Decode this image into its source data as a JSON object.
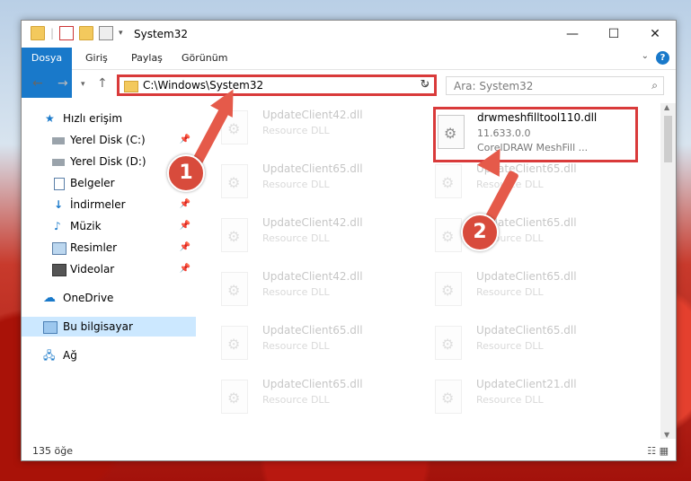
{
  "window": {
    "title": "System32",
    "controls": {
      "minimize": "—",
      "maximize": "☐",
      "close": "✕"
    }
  },
  "ribbon": {
    "tabs": [
      "Dosya",
      "Giriş",
      "Paylaş",
      "Görünüm"
    ],
    "help": "?"
  },
  "address": {
    "path": "C:\\Windows\\System32",
    "search_placeholder": "Ara: System32"
  },
  "sidebar": {
    "items": [
      {
        "label": "Hızlı erişim",
        "icon": "star-icon"
      },
      {
        "label": "Yerel Disk (C:)",
        "icon": "drive-icon",
        "pinned": true
      },
      {
        "label": "Yerel Disk (D:)",
        "icon": "drive-icon"
      },
      {
        "label": "Belgeler",
        "icon": "documents-icon",
        "pinned": true
      },
      {
        "label": "İndirmeler",
        "icon": "download-icon",
        "pinned": true
      },
      {
        "label": "Müzik",
        "icon": "music-icon",
        "pinned": true
      },
      {
        "label": "Resimler",
        "icon": "pictures-icon",
        "pinned": true
      },
      {
        "label": "Videolar",
        "icon": "videos-icon",
        "pinned": true
      },
      {
        "label": "OneDrive",
        "icon": "cloud-icon"
      },
      {
        "label": "Bu bilgisayar",
        "icon": "computer-icon",
        "selected": true
      },
      {
        "label": "Ağ",
        "icon": "network-icon"
      }
    ]
  },
  "files": {
    "highlight": {
      "name": "drwmeshfilltool110.dll",
      "version": "11.633.0.0",
      "desc": "CorelDRAW MeshFill ..."
    },
    "left": [
      {
        "name": "UpdateClient42.dll",
        "type": "Resource DLL"
      },
      {
        "name": "UpdateClient65.dll",
        "type": "Resource DLL"
      },
      {
        "name": "UpdateClient42.dll",
        "type": "Resource DLL"
      },
      {
        "name": "UpdateClient42.dll",
        "type": "Resource DLL"
      },
      {
        "name": "UpdateClient65.dll",
        "type": "Resource DLL"
      },
      {
        "name": "UpdateClient65.dll",
        "type": "Resource DLL"
      }
    ],
    "right": [
      {
        "name": "UpdateClient65.dll",
        "type": "Resource DLL"
      },
      {
        "name": "UpdateClient65.dll",
        "type": "Resource DLL"
      },
      {
        "name": "UpdateClient65.dll",
        "type": "Resource DLL"
      },
      {
        "name": "UpdateClient65.dll",
        "type": "Resource DLL"
      },
      {
        "name": "UpdateClient21.dll",
        "type": "Resource DLL"
      }
    ]
  },
  "status": {
    "count": "135 öğe"
  },
  "annotations": {
    "step1": "1",
    "step2": "2"
  },
  "colors": {
    "accent": "#1979ca",
    "highlight": "#d93a3a",
    "arrow": "#e55a4a"
  }
}
